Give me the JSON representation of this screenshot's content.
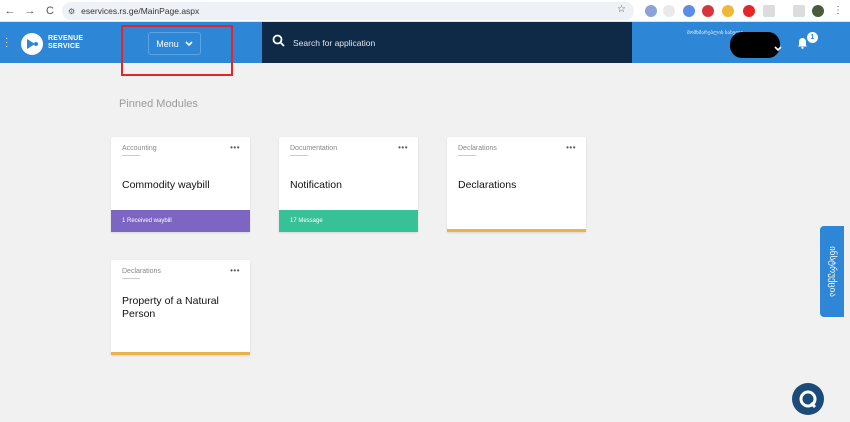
{
  "browser": {
    "url": "eservices.rs.ge/MainPage.aspx"
  },
  "header": {
    "logo_line1": "REVENUE",
    "logo_line2": "SERVICE",
    "menu_label": "Menu",
    "search_placeholder": "Search for application",
    "user_label": "მომხმარებლის სახელი",
    "notification_count": "1"
  },
  "main": {
    "section_title": "Pinned Modules",
    "cards": [
      {
        "category": "Accounting",
        "title": "Commodity waybill",
        "footer": "1 Received waybill",
        "footer_color": "#7c65c3"
      },
      {
        "category": "Documentation",
        "title": "Notification",
        "footer": "17 Message",
        "footer_color": "#36c196"
      },
      {
        "category": "Declarations",
        "title": "Declarations",
        "footer": "",
        "footer_color": "#e9b24d"
      },
      {
        "category": "Declarations",
        "title": "Property of a Natural Person",
        "footer": "",
        "footer_color": "#e9b24d"
      }
    ]
  },
  "side_tab": {
    "label": "ინსტრუქცია"
  },
  "icons": {
    "logo": "revenue-service-logo-icon",
    "search": "search-icon",
    "bell": "bell-icon",
    "chat": "chat-support-icon"
  }
}
